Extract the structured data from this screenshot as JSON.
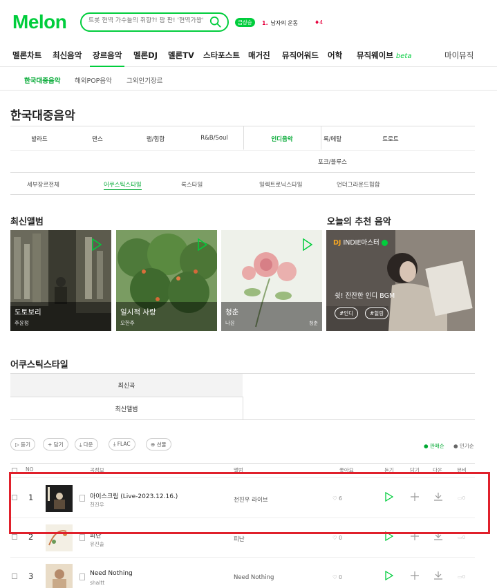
{
  "header": {
    "logo": "Melon",
    "search_placeholder": "트롯 현역 가수들의 취향?! 팜 판! '현역가왕'",
    "trend_badge": "급상승",
    "trend_rank": "1.",
    "trend_keyword": "남자의 운동",
    "trend_change": "♦4"
  },
  "gnb": [
    "멜론차트",
    "최신음악",
    "장르음악",
    "멜론DJ",
    "멜론TV",
    "스타포스트",
    "매거진",
    "뮤직어워드",
    "어학",
    "뮤직웨이브"
  ],
  "gnb_beta": "beta",
  "gnb_right": "마이뮤직",
  "lnb": [
    "한국대중음악",
    "해외POP음악",
    "그외인기장르"
  ],
  "page_title": "한국대중음악",
  "genres": [
    "발라드",
    "댄스",
    "랩/힙합",
    "R&B/Soul",
    "인디음악",
    "록/메탈",
    "트로트",
    "포크/블루스"
  ],
  "subgenres": [
    "세부장르전체",
    "어쿠스틱스타일",
    "록스타일",
    "일렉트로닉스타일",
    "언더그라운드힙합"
  ],
  "sections": {
    "new_albums": "최신앨범",
    "recommend": "오늘의 추천 음악",
    "acoustic": "어쿠스틱스타일"
  },
  "albums": [
    {
      "title": "도토보리",
      "artist": "주윤정",
      "extra": ""
    },
    {
      "title": "일시적 사랑",
      "artist": "오한주",
      "extra": ""
    },
    {
      "title": "청춘",
      "artist": "나윤",
      "extra": "청춘"
    }
  ],
  "recommend": {
    "dj_label": "DJ",
    "dj_name": "INDIE마스터",
    "message": "쉿! 잔잔한 인디 BGM",
    "tags": [
      "#인디",
      "#힐링"
    ]
  },
  "category_tabs": [
    "최신곡",
    "최신앨범"
  ],
  "toolbar": [
    "듣기",
    "담기",
    "다운",
    "FLAC",
    "선물"
  ],
  "sort": [
    "판매순",
    "인기순"
  ],
  "columns": [
    "NO",
    "곡정보",
    "앨범",
    "좋아요",
    "듣기",
    "담기",
    "다운",
    "뮤비"
  ],
  "songs": [
    {
      "no": "1",
      "title": "아이스크림 (Live-2023.12.16.)",
      "artist": "천진우",
      "album": "천진우 라이브",
      "likes": "6",
      "mv": "0"
    },
    {
      "no": "2",
      "title": "피난",
      "artist": "유진솔",
      "album": "피난",
      "likes": "0",
      "mv": "0"
    },
    {
      "no": "3",
      "title": "Need Nothing",
      "artist": "shaltt",
      "album": "Need Nothing",
      "likes": "0",
      "mv": "0"
    }
  ],
  "colors": {
    "brand": "#00cd3c",
    "highlight": "#e0202b"
  }
}
